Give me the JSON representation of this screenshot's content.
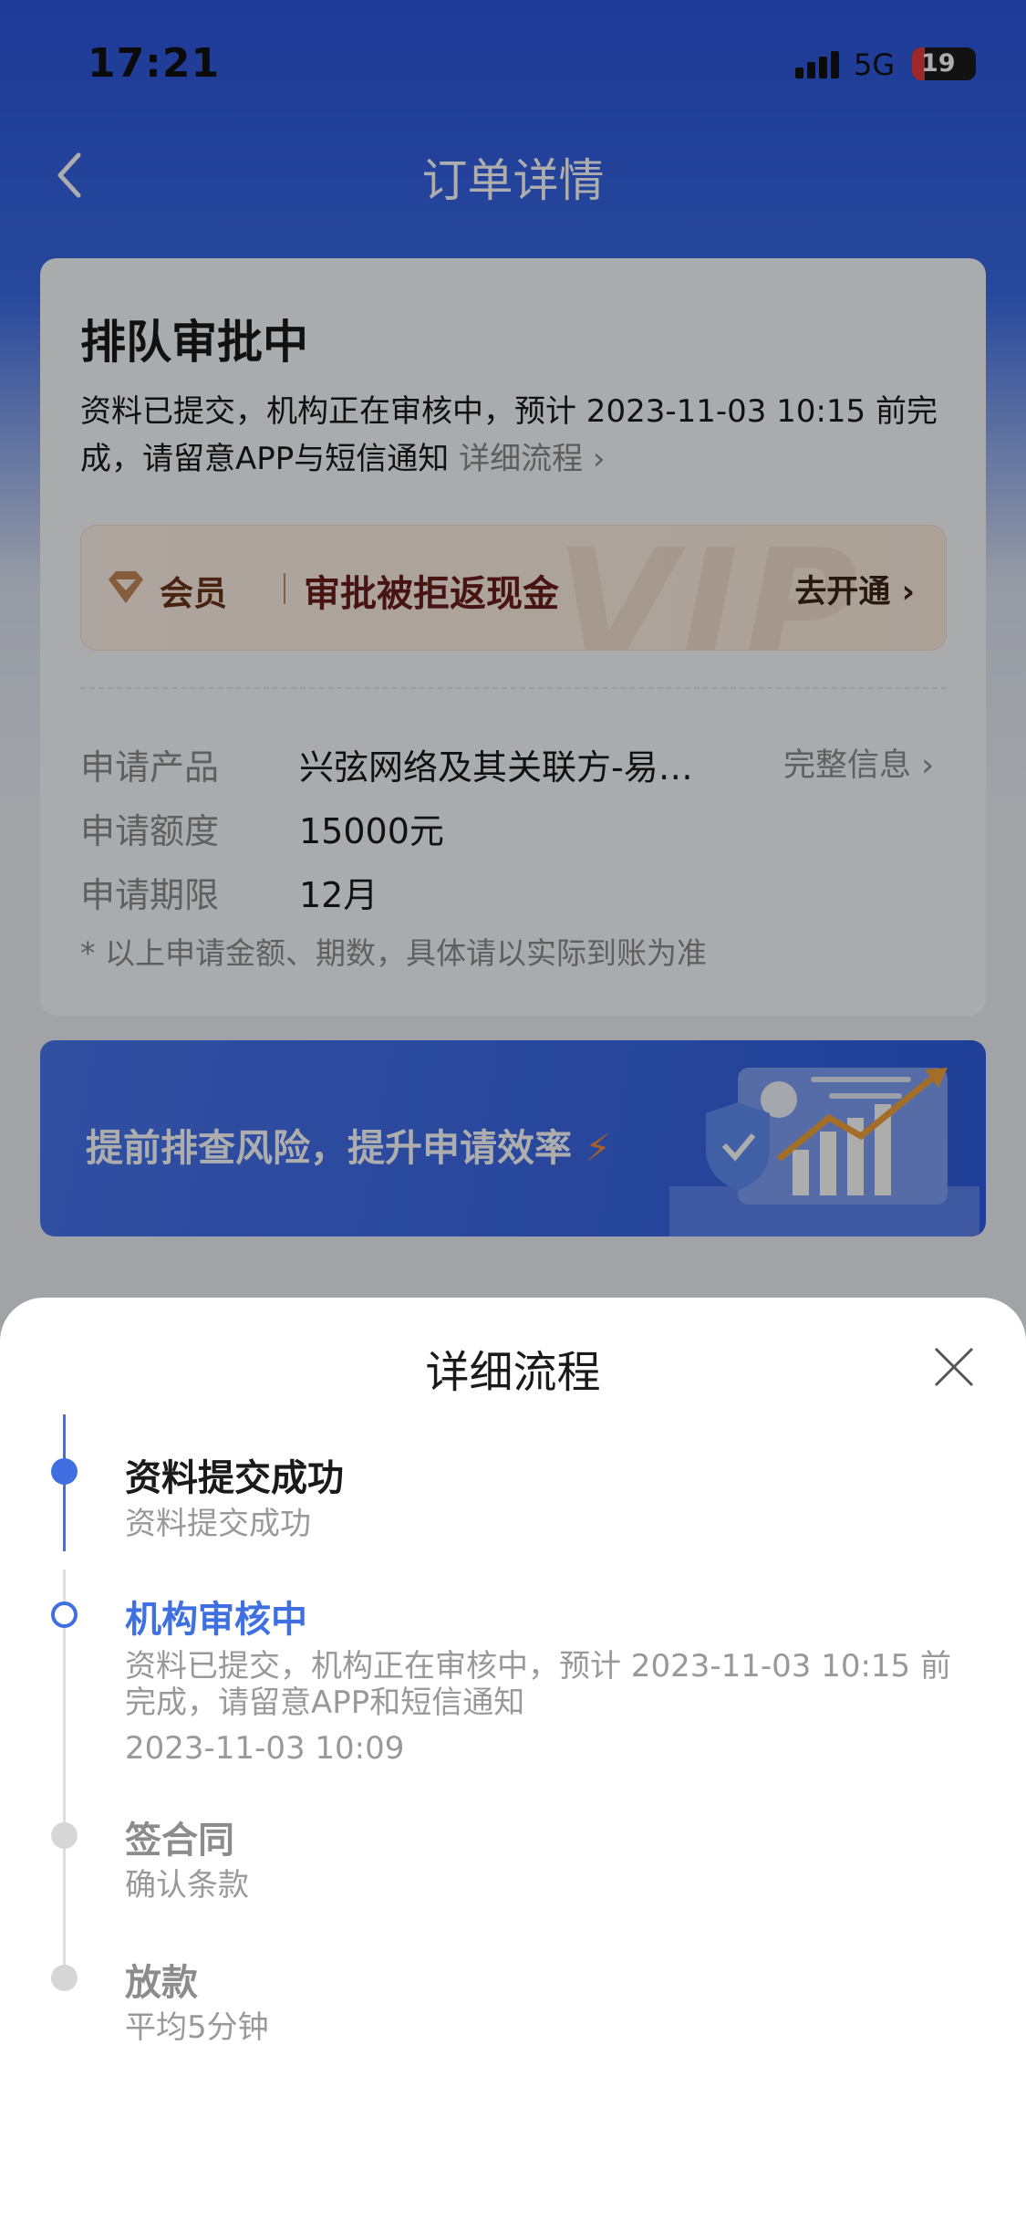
{
  "status_bar": {
    "time": "17:21",
    "network": "5G",
    "battery": "19"
  },
  "nav": {
    "title": "订单详情"
  },
  "order_card": {
    "status_title": "排队审批中",
    "desc": "资料已提交，机构正在审核中，预计 2023-11-03 10:15 前完成，请留意APP与短信通知",
    "desc_link": "详细流程 ›",
    "vip": {
      "member_label": "会员",
      "text": "审批被拒返现金",
      "button": "去开通 ›",
      "watermark": "VIP"
    },
    "info": [
      {
        "label": "申请产品",
        "value": "兴弦网络及其关联方-易…"
      },
      {
        "label": "申请额度",
        "value": "15000元"
      },
      {
        "label": "申请期限",
        "value": "12月"
      }
    ],
    "full_info_link": "完整信息 ›",
    "note": "* 以上申请金额、期数，具体请以实际到账为准"
  },
  "banner": {
    "text": "提前排查风险，提升申请效率"
  },
  "sheet": {
    "title": "详细流程",
    "steps": [
      {
        "title": "资料提交成功",
        "desc": "资料提交成功",
        "state": "done"
      },
      {
        "title": "机构审核中",
        "desc": "资料已提交，机构正在审核中，预计 2023-11-03 10:15 前完成，请留意APP和短信通知",
        "time": "2023-11-03 10:09",
        "state": "current"
      },
      {
        "title": "签合同",
        "desc": "确认条款",
        "state": "pending"
      },
      {
        "title": "放款",
        "desc": "平均5分钟",
        "state": "pending"
      }
    ]
  },
  "colors": {
    "accent": "#3f6fe0",
    "pending": "#d6d6d6"
  }
}
